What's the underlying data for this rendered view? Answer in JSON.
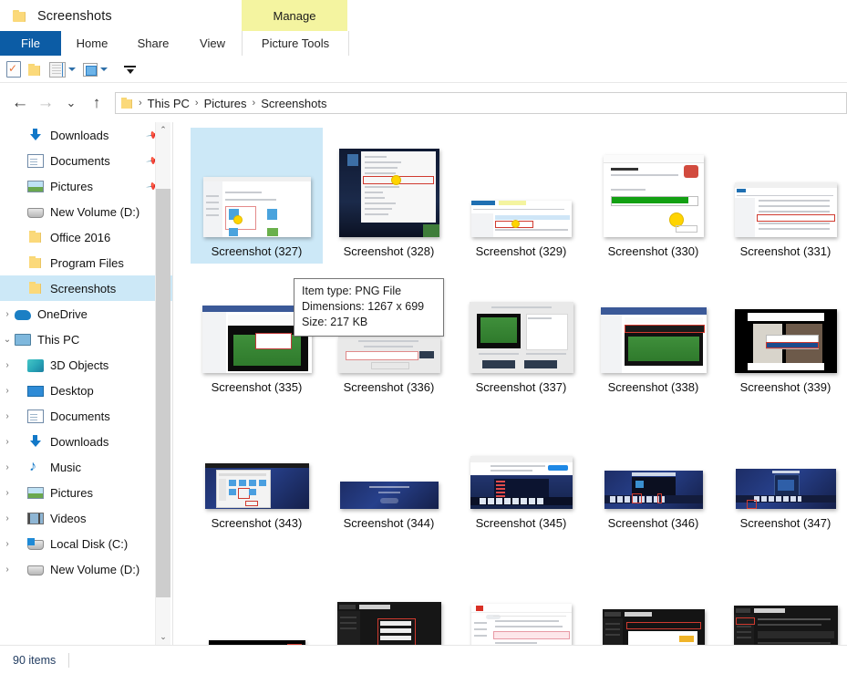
{
  "window": {
    "title": "Screenshots",
    "folder_icon": "folder-icon"
  },
  "ribbon": {
    "contextual_group": "Manage",
    "tabs": [
      {
        "label": "File",
        "name": "tab-file"
      },
      {
        "label": "Home",
        "name": "tab-home"
      },
      {
        "label": "Share",
        "name": "tab-share"
      },
      {
        "label": "View",
        "name": "tab-view"
      },
      {
        "label": "Picture Tools",
        "name": "tab-picture-tools"
      }
    ],
    "accent_color": "#0c5ca5",
    "contextual_color": "#f4f4a0"
  },
  "quick_access": {
    "items": [
      {
        "name": "properties-icon",
        "label": "Properties"
      },
      {
        "name": "new-folder-icon",
        "label": "New folder"
      },
      {
        "name": "list-size-icon",
        "label": "Customize list"
      },
      {
        "name": "preview-pane-icon",
        "label": "Preview pane"
      },
      {
        "name": "customize-qat-icon",
        "label": "Customize Quick Access Toolbar"
      }
    ]
  },
  "address_bar": {
    "back": "←",
    "forward": "→",
    "recent": "⌄",
    "up": "↑",
    "separator": "›",
    "crumbs": [
      "This PC",
      "Pictures",
      "Screenshots"
    ]
  },
  "sidebar": {
    "items": [
      {
        "label": "Downloads",
        "icon": "download-icon",
        "chevron": "",
        "pinned": true,
        "indent": 1,
        "selected": false
      },
      {
        "label": "Documents",
        "icon": "document-icon",
        "chevron": "",
        "pinned": true,
        "indent": 1,
        "selected": false
      },
      {
        "label": "Pictures",
        "icon": "picture-icon",
        "chevron": "",
        "pinned": true,
        "indent": 1,
        "selected": false
      },
      {
        "label": "New Volume (D:)",
        "icon": "drive-icon",
        "chevron": "",
        "pinned": false,
        "indent": 1,
        "selected": false
      },
      {
        "label": "Office 2016",
        "icon": "folder-icon",
        "chevron": "",
        "pinned": false,
        "indent": 1,
        "selected": false
      },
      {
        "label": "Program Files",
        "icon": "folder-icon",
        "chevron": "",
        "pinned": false,
        "indent": 1,
        "selected": false
      },
      {
        "label": "Screenshots",
        "icon": "folder-icon",
        "chevron": "",
        "pinned": false,
        "indent": 1,
        "selected": true
      },
      {
        "label": "OneDrive",
        "icon": "onedrive-icon",
        "chevron": "›",
        "pinned": false,
        "indent": 0,
        "selected": false
      },
      {
        "label": "This PC",
        "icon": "pc-icon",
        "chevron": "⌄",
        "pinned": false,
        "indent": 0,
        "selected": false
      },
      {
        "label": "3D Objects",
        "icon": "cube-icon",
        "chevron": "›",
        "pinned": false,
        "indent": 1,
        "selected": false
      },
      {
        "label": "Desktop",
        "icon": "desktop-icon",
        "chevron": "›",
        "pinned": false,
        "indent": 1,
        "selected": false
      },
      {
        "label": "Documents",
        "icon": "document-icon",
        "chevron": "›",
        "pinned": false,
        "indent": 1,
        "selected": false
      },
      {
        "label": "Downloads",
        "icon": "download-icon",
        "chevron": "›",
        "pinned": false,
        "indent": 1,
        "selected": false
      },
      {
        "label": "Music",
        "icon": "music-icon",
        "chevron": "›",
        "pinned": false,
        "indent": 1,
        "selected": false
      },
      {
        "label": "Pictures",
        "icon": "picture-icon",
        "chevron": "›",
        "pinned": false,
        "indent": 1,
        "selected": false
      },
      {
        "label": "Videos",
        "icon": "video-icon",
        "chevron": "›",
        "pinned": false,
        "indent": 1,
        "selected": false
      },
      {
        "label": "Local Disk (C:)",
        "icon": "drive-c-icon",
        "chevron": "›",
        "pinned": false,
        "indent": 1,
        "selected": false
      },
      {
        "label": "New Volume (D:)",
        "icon": "drive-icon",
        "chevron": "›",
        "pinned": false,
        "indent": 1,
        "selected": false
      }
    ],
    "scroll_up": "⌃",
    "scroll_down": "⌄",
    "selection_color": "#cce8f7"
  },
  "files": [
    {
      "label": "Screenshot (327)",
      "selected": true,
      "thumb": "settings-security"
    },
    {
      "label": "Screenshot (328)",
      "selected": false,
      "thumb": "desktop-contextmenu"
    },
    {
      "label": "Screenshot (329)",
      "selected": false,
      "thumb": "explorer-window"
    },
    {
      "label": "Screenshot (330)",
      "selected": false,
      "thumb": "installer-progress"
    },
    {
      "label": "Screenshot (331)",
      "selected": false,
      "thumb": "explorer-list"
    },
    {
      "label": "Screenshot (335)",
      "selected": false,
      "thumb": "facebook-video"
    },
    {
      "label": "Screenshot (336)",
      "selected": false,
      "thumb": "downloader-page"
    },
    {
      "label": "Screenshot (337)",
      "selected": false,
      "thumb": "downloader-result"
    },
    {
      "label": "Screenshot (338)",
      "selected": false,
      "thumb": "football-browser"
    },
    {
      "label": "Screenshot (339)",
      "selected": false,
      "thumb": "tiktok-reaction"
    },
    {
      "label": "Screenshot (343)",
      "selected": false,
      "thumb": "blue-desktop-dialog"
    },
    {
      "label": "Screenshot (344)",
      "selected": false,
      "thumb": "blue-loading"
    },
    {
      "label": "Screenshot (345)",
      "selected": false,
      "thumb": "video-editor"
    },
    {
      "label": "Screenshot (346)",
      "selected": false,
      "thumb": "video-editor-dark"
    },
    {
      "label": "Screenshot (347)",
      "selected": false,
      "thumb": "video-editor-phone"
    },
    {
      "label": "",
      "selected": false,
      "thumb": "dark-toolbar"
    },
    {
      "label": "",
      "selected": false,
      "thumb": "dark-form"
    },
    {
      "label": "",
      "selected": false,
      "thumb": "gmail-message"
    },
    {
      "label": "",
      "selected": false,
      "thumb": "dark-panel"
    },
    {
      "label": "",
      "selected": false,
      "thumb": "dark-article"
    }
  ],
  "tooltip": {
    "item_type": "Item type: PNG File",
    "dimensions": "Dimensions: 1267 x 699",
    "size": "Size: 217 KB"
  },
  "status_bar": {
    "item_count": "90 items"
  }
}
